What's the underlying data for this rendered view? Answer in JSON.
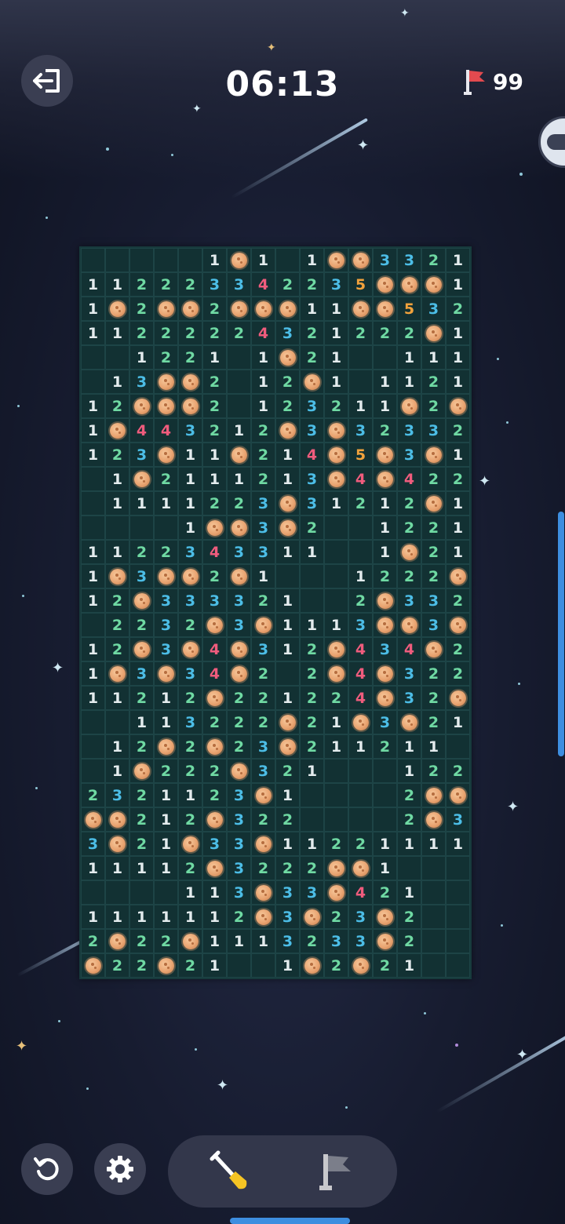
{
  "header": {
    "exit_icon": "exit-door-icon",
    "timer": "06:13",
    "flag_icon": "red-flag-icon",
    "flags_remaining": "99"
  },
  "board": {
    "cols": 16,
    "rows": 30,
    "legend": "M = mine, blank = revealed empty, digits = adjacent mine count",
    "number_colors": {
      "1": "#e4ecee",
      "2": "#6fd9a3",
      "3": "#4cbde6",
      "4": "#ef5c7d",
      "5": "#f1a23c"
    },
    "grid": [
      [
        "",
        "",
        "",
        "",
        "",
        "1",
        "M",
        "1",
        "",
        "1",
        "M",
        "M",
        "3",
        "3",
        "2",
        "1"
      ],
      [
        "1",
        "1",
        "2",
        "2",
        "2",
        "3",
        "3",
        "4",
        "2",
        "2",
        "3",
        "5",
        "M",
        "M",
        "M",
        "1"
      ],
      [
        "1",
        "M",
        "2",
        "M",
        "M",
        "2",
        "M",
        "M",
        "M",
        "1",
        "1",
        "M",
        "M",
        "5",
        "3",
        "2"
      ],
      [
        "1",
        "1",
        "2",
        "2",
        "2",
        "2",
        "2",
        "4",
        "3",
        "2",
        "1",
        "2",
        "2",
        "2",
        "M",
        "1"
      ],
      [
        "",
        "",
        "1",
        "2",
        "2",
        "1",
        "",
        "1",
        "M",
        "2",
        "1",
        "",
        "",
        "1",
        "1",
        "1"
      ],
      [
        "",
        "1",
        "3",
        "M",
        "M",
        "2",
        "",
        "1",
        "2",
        "M",
        "1",
        "",
        "1",
        "1",
        "2",
        "1"
      ],
      [
        "1",
        "2",
        "M",
        "M",
        "M",
        "2",
        "",
        "1",
        "2",
        "3",
        "2",
        "1",
        "1",
        "M",
        "2",
        "M"
      ],
      [
        "1",
        "M",
        "4",
        "4",
        "3",
        "2",
        "1",
        "2",
        "M",
        "3",
        "M",
        "3",
        "2",
        "3",
        "3",
        "2"
      ],
      [
        "1",
        "2",
        "3",
        "M",
        "1",
        "1",
        "M",
        "2",
        "1",
        "4",
        "M",
        "5",
        "M",
        "3",
        "M",
        "1"
      ],
      [
        "",
        "1",
        "M",
        "2",
        "1",
        "1",
        "1",
        "2",
        "1",
        "3",
        "M",
        "4",
        "M",
        "4",
        "2",
        "2"
      ],
      [
        "",
        "1",
        "1",
        "1",
        "1",
        "2",
        "2",
        "3",
        "M",
        "3",
        "1",
        "2",
        "1",
        "2",
        "M",
        "1"
      ],
      [
        "",
        "",
        "",
        "",
        "1",
        "M",
        "M",
        "3",
        "M",
        "2",
        "",
        "",
        "1",
        "2",
        "2",
        "1"
      ],
      [
        "1",
        "1",
        "2",
        "2",
        "3",
        "4",
        "3",
        "3",
        "1",
        "1",
        "",
        "",
        "1",
        "M",
        "2",
        "1"
      ],
      [
        "1",
        "M",
        "3",
        "M",
        "M",
        "2",
        "M",
        "1",
        "",
        "",
        "",
        "1",
        "2",
        "2",
        "2",
        "M"
      ],
      [
        "1",
        "2",
        "M",
        "3",
        "3",
        "3",
        "3",
        "2",
        "1",
        "",
        "",
        "2",
        "M",
        "3",
        "3",
        "2"
      ],
      [
        "",
        "2",
        "2",
        "3",
        "2",
        "M",
        "3",
        "M",
        "1",
        "1",
        "1",
        "3",
        "M",
        "M",
        "3",
        "M"
      ],
      [
        "1",
        "2",
        "M",
        "3",
        "M",
        "4",
        "M",
        "3",
        "1",
        "2",
        "M",
        "4",
        "3",
        "4",
        "M",
        "2"
      ],
      [
        "1",
        "M",
        "3",
        "M",
        "3",
        "4",
        "M",
        "2",
        "",
        "2",
        "M",
        "4",
        "M",
        "3",
        "2",
        "2"
      ],
      [
        "1",
        "1",
        "2",
        "1",
        "2",
        "M",
        "2",
        "2",
        "1",
        "2",
        "2",
        "4",
        "M",
        "3",
        "2",
        "M"
      ],
      [
        "",
        "",
        "1",
        "1",
        "3",
        "2",
        "2",
        "2",
        "M",
        "2",
        "1",
        "M",
        "3",
        "M",
        "2",
        "1"
      ],
      [
        "",
        "1",
        "2",
        "M",
        "2",
        "M",
        "2",
        "3",
        "M",
        "2",
        "1",
        "1",
        "2",
        "1",
        "1",
        ""
      ],
      [
        "",
        "1",
        "M",
        "2",
        "2",
        "2",
        "M",
        "3",
        "2",
        "1",
        "",
        "",
        "",
        "1",
        "2",
        "2"
      ],
      [
        "2",
        "3",
        "2",
        "1",
        "1",
        "2",
        "3",
        "M",
        "1",
        "",
        "",
        "",
        "",
        "2",
        "M",
        "M"
      ],
      [
        "M",
        "M",
        "2",
        "1",
        "2",
        "M",
        "3",
        "2",
        "2",
        "",
        "",
        "",
        "",
        "2",
        "M",
        "3"
      ],
      [
        "3",
        "M",
        "2",
        "1",
        "M",
        "3",
        "3",
        "M",
        "1",
        "1",
        "2",
        "2",
        "1",
        "1",
        "1",
        "1"
      ],
      [
        "1",
        "1",
        "1",
        "1",
        "2",
        "M",
        "3",
        "2",
        "2",
        "2",
        "M",
        "M",
        "1",
        "",
        "",
        ""
      ],
      [
        "",
        "",
        "",
        "",
        "1",
        "1",
        "3",
        "M",
        "3",
        "3",
        "M",
        "4",
        "2",
        "1",
        "",
        ""
      ],
      [
        "1",
        "1",
        "1",
        "1",
        "1",
        "1",
        "2",
        "M",
        "3",
        "M",
        "2",
        "3",
        "M",
        "2",
        "",
        ""
      ],
      [
        "2",
        "M",
        "2",
        "2",
        "M",
        "1",
        "1",
        "1",
        "3",
        "2",
        "3",
        "3",
        "M",
        "2",
        "",
        ""
      ],
      [
        "M",
        "2",
        "2",
        "M",
        "2",
        "1",
        "",
        "",
        "1",
        "M",
        "2",
        "M",
        "2",
        "1",
        "",
        ""
      ]
    ]
  },
  "footer": {
    "undo_icon": "restart-icon",
    "settings_icon": "gear-icon",
    "tools": [
      {
        "name": "shovel-tool",
        "icon": "shovel-icon",
        "active": true
      },
      {
        "name": "flag-tool",
        "icon": "gray-flag-icon",
        "active": false
      }
    ]
  }
}
